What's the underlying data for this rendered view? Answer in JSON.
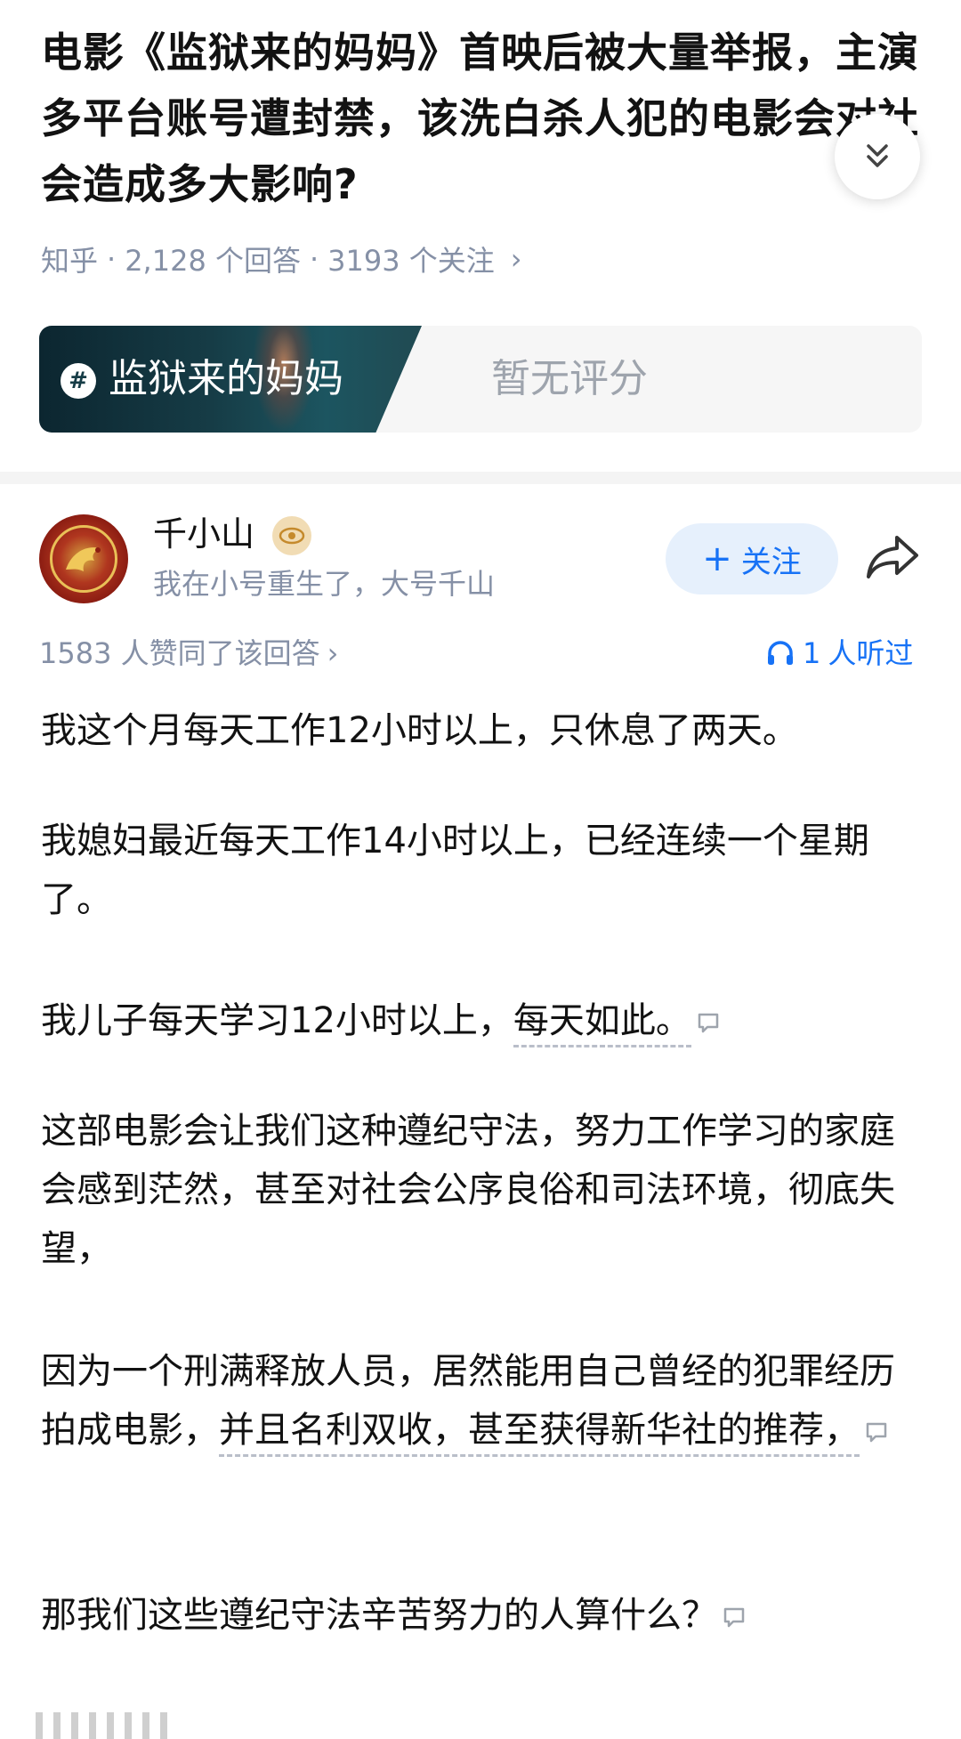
{
  "question": {
    "title": "电影《监狱来的妈妈》首映后被大量举报，主演多平台账号遭封禁，该洗白杀人犯的电影会对社会造成多大影响?",
    "source": "知乎",
    "answers": "2,128 个回答",
    "followers": "3193 个关注",
    "meta_chevron": "›"
  },
  "movie_card": {
    "tag_icon": "#",
    "name": "监狱来的妈妈",
    "score_text": "暂无评分"
  },
  "answer": {
    "author_name": "千小山",
    "author_bio": "我在小号重生了，大号千山",
    "follow_label": "关注",
    "follow_plus": "+",
    "vote_text": "1583 人赞同了该回答",
    "vote_chevron": "›",
    "listen_count": "1",
    "listen_text": "人听过",
    "paragraphs": {
      "p1": "我这个月每天工作12小时以上，只休息了两天。",
      "p2": "我媳妇最近每天工作14小时以上，已经连续一个星期了。",
      "p3_a": "我儿子每天学习12小时以上，",
      "p3_link": "每天如此。",
      "p4": "这部电影会让我们这种遵纪守法，努力工作学习的家庭会感到茫然，甚至对社会公序良俗和司法环境，彻底失望，",
      "p5_a": "因为一个刑满释放人员，居然能用自己曾经的犯罪经历拍成电影，",
      "p5_link": "并且名利双收，甚至获得新华社的推荐，",
      "p6": "那我们这些遵纪守法辛苦努力的人算什么？"
    }
  },
  "colors": {
    "accent_blue": "#1772f6",
    "meta_gray": "#8590a6",
    "text_dark": "#121212"
  }
}
